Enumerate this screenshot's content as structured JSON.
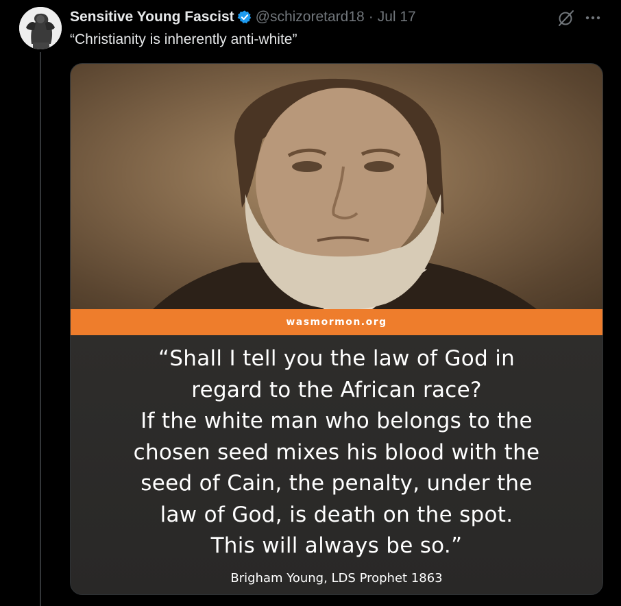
{
  "tweet": {
    "display_name": "Sensitive Young Fascist",
    "handle": "@schizoretard18",
    "separator": "·",
    "date": "Jul 17",
    "text": "“Christianity is inherently anti-white”",
    "icons": {
      "verified": "verified-badge-icon",
      "grok": "grok-icon",
      "more": "more-options-icon",
      "avatar": "avatar"
    },
    "colors": {
      "background": "#000000",
      "text": "#e7e9ea",
      "muted": "#71767b",
      "verified": "#1d9bf0"
    }
  },
  "media": {
    "banner_text": "wasmormon.org",
    "banner_color": "#ee7d2c",
    "quote_lines": [
      "“Shall I tell you the law of God in",
      "regard to the African race?",
      "If the white man who belongs to the",
      "chosen seed mixes his blood with the",
      "seed of Cain, the penalty, under the",
      "law of God, is death on the spot.",
      "This will always be so.”"
    ],
    "attribution": "Brigham Young, LDS Prophet 1863"
  }
}
